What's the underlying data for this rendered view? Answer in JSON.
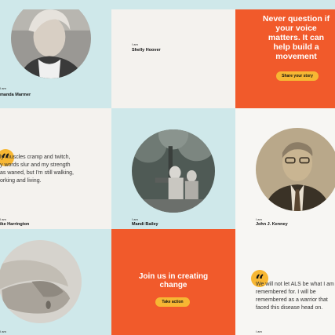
{
  "cards": {
    "amanda": {
      "iam": "I am",
      "name": "manda Marmer"
    },
    "shelly": {
      "iam": "I am",
      "name": "Shelly Hoover"
    },
    "cta_story": {
      "headline_lines": [
        "Never question if",
        "your voice",
        "matters. It can",
        "help build a",
        "movement"
      ],
      "button_label": "Share your story"
    },
    "mike": {
      "quote_lines": [
        "ly muscles cramp and twitch,",
        "y words slur and my strength",
        "as waned, but I'm still walking,",
        "orking and living."
      ],
      "iam": "I am",
      "name": "ike Harrington"
    },
    "mandi": {
      "iam": "I am",
      "name": "Mandi Bailey"
    },
    "john": {
      "iam": "I am",
      "name": "John J. Kenney"
    },
    "hands": {
      "iam": "I am"
    },
    "cta_join": {
      "headline_lines": [
        "Join us in creating",
        "change"
      ],
      "button_label": "Take action"
    },
    "quote_als": {
      "quote_lines": [
        "We will not let ALS be what I am",
        "remembered for. I will be",
        "remembered as a warrior that",
        "faced this disease head on."
      ],
      "iam": "I am"
    }
  },
  "colors": {
    "teal": "#cfe8ea",
    "cream": "#f4f2ee",
    "orange": "#f15a2b",
    "yellow": "#f7b733"
  },
  "icons": {
    "quote": "quote-mark-icon"
  }
}
